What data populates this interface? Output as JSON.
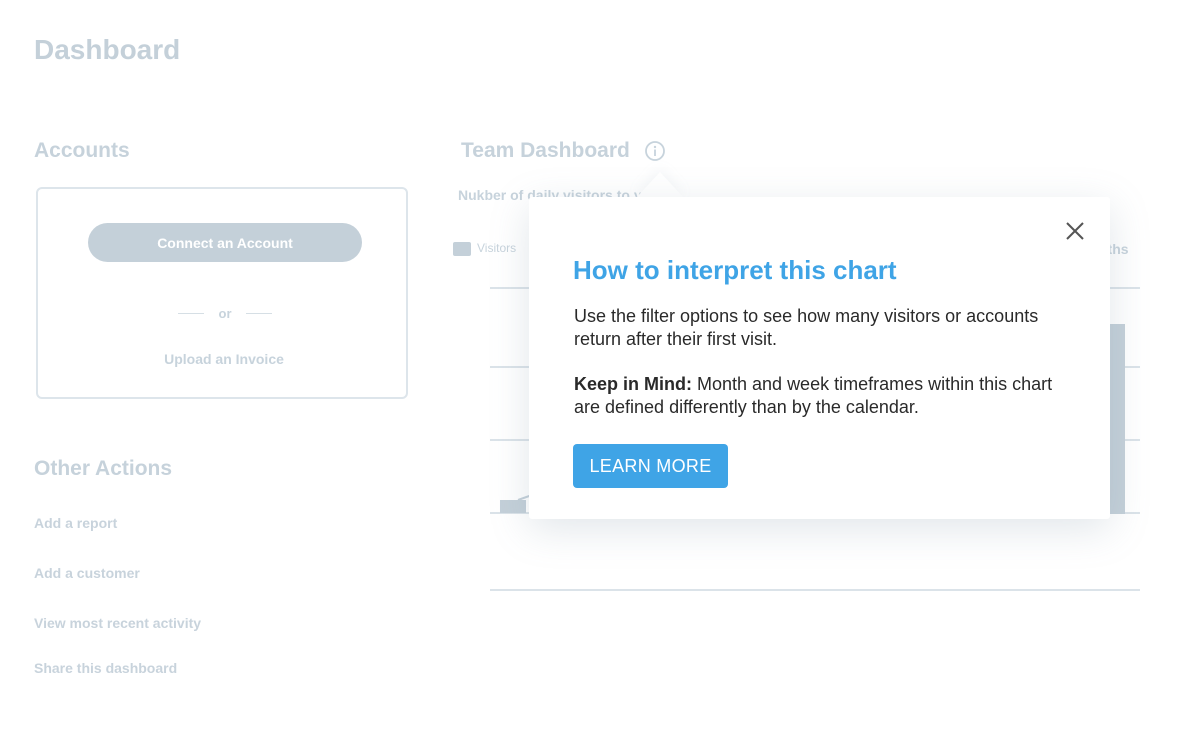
{
  "page": {
    "title": "Dashboard"
  },
  "accounts": {
    "title": "Accounts",
    "connect_label": "Connect an Account",
    "or_label": "or",
    "upload_label": "Upload an Invoice"
  },
  "other_actions": {
    "title": "Other Actions",
    "items": [
      {
        "label": "Add a report"
      },
      {
        "label": "Add a customer"
      },
      {
        "label": "View most recent activity"
      },
      {
        "label": "Share this dashboard"
      }
    ]
  },
  "team_dashboard": {
    "title": "Team Dashboard",
    "subtitle": "Nukber of daily visitors to y",
    "legend": [
      {
        "label": "Visitors",
        "color": "#c4d0d9"
      }
    ],
    "range_label": "nths"
  },
  "chart_data": {
    "type": "bar",
    "series": [
      {
        "name": "Visitors"
      }
    ],
    "categories": [],
    "values": [],
    "grid": true
  },
  "popover": {
    "title": "How to interpret this chart",
    "body_1": "Use the filter options to see how many visitors or accounts return after their first visit.",
    "body_2_bold": "Keep in Mind:",
    "body_2_rest": " Month and week timeframes within this chart are defined differently than by the calendar.",
    "button_label": "LEARN MORE",
    "close_icon": "close-icon"
  },
  "colors": {
    "accent": "#3fa4e6",
    "muted": "#c4d0d9",
    "text": "#2a2a2a"
  }
}
